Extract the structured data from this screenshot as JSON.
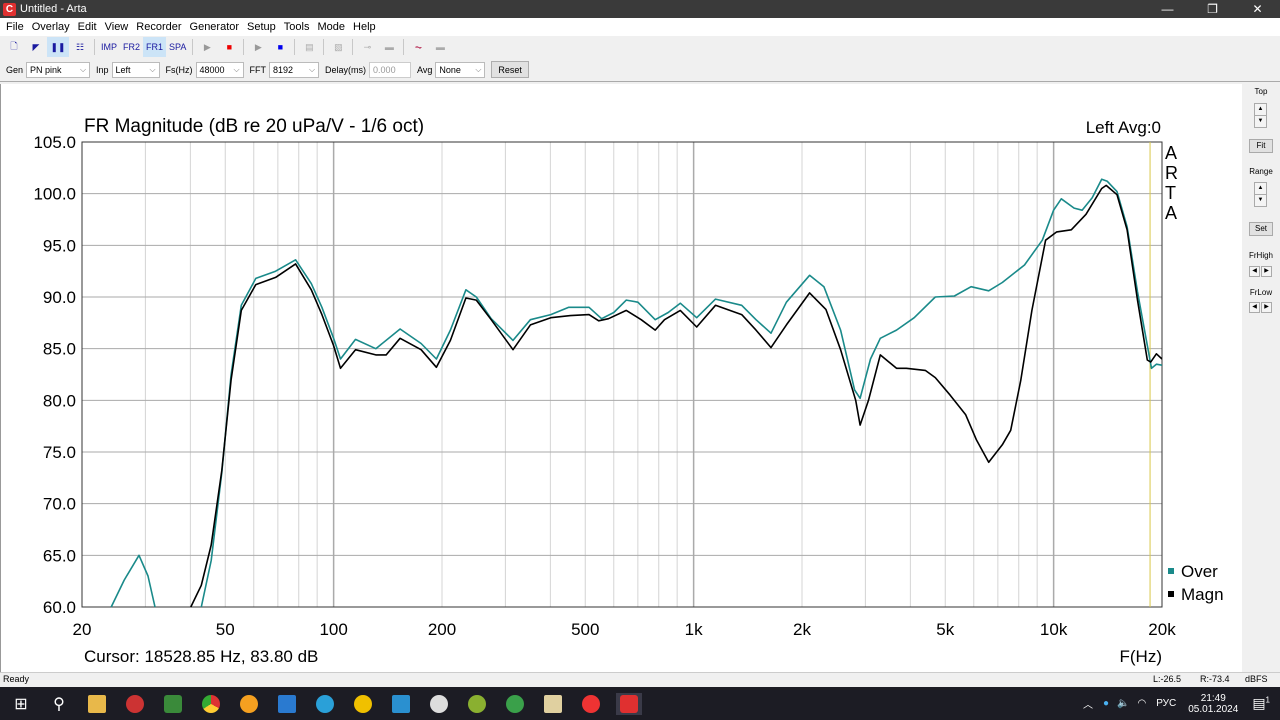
{
  "window": {
    "title": "Untitled - Arta",
    "minimize": "—",
    "maximize": "❐",
    "close": "✕"
  },
  "menu": [
    "File",
    "Overlay",
    "Edit",
    "View",
    "Recorder",
    "Generator",
    "Setup",
    "Tools",
    "Mode",
    "Help"
  ],
  "toolbar": {
    "imp": "IMP",
    "fr2": "FR2",
    "fr1": "FR1",
    "spa": "SPA"
  },
  "params": {
    "gen_label": "Gen",
    "gen_value": "PN pink",
    "inp_label": "Inp",
    "inp_value": "Left",
    "fs_label": "Fs(Hz)",
    "fs_value": "48000",
    "fft_label": "FFT",
    "fft_value": "8192",
    "delay_label": "Delay(ms)",
    "delay_value": "0.000",
    "avg_label": "Avg",
    "avg_value": "None",
    "reset": "Reset"
  },
  "right_panel": {
    "top": "Top",
    "fit": "Fit",
    "range": "Range",
    "set": "Set",
    "frhigh": "FrHigh",
    "frlow": "FrLow"
  },
  "status": {
    "ready": "Ready",
    "left": "L:-26.5",
    "right": "R:-73.4",
    "unit": "dBFS"
  },
  "tray": {
    "lang": "РУС",
    "time": "21:49",
    "date": "05.01.2024",
    "notif": "1"
  },
  "colors": {
    "over": "#1a8a8a",
    "magn": "#000000",
    "cursor": "#d8c84a",
    "grid": "#c8c8c8"
  },
  "chart_data": {
    "type": "line",
    "title": "FR Magnitude (dB re 20 uPa/V - 1/6 oct)",
    "channel_label": "Left  Avg:0",
    "watermark": "ARTA",
    "xlabel": "F(Hz)",
    "xscale": "log",
    "xlim": [
      20,
      20000
    ],
    "ylim": [
      60,
      105
    ],
    "xticks": [
      20,
      50,
      100,
      200,
      500,
      1000,
      2000,
      5000,
      10000,
      20000
    ],
    "xtick_labels": [
      "20",
      "50",
      "100",
      "200",
      "500",
      "1k",
      "2k",
      "5k",
      "10k",
      "20k"
    ],
    "yticks": [
      105,
      100,
      95,
      90,
      85,
      80,
      75,
      70,
      65,
      60
    ],
    "ytick_labels": [
      "105.0",
      "100.0",
      "95.0",
      "90.0",
      "85.0",
      "80.0",
      "75.0",
      "70.0",
      "65.0",
      "60.0"
    ],
    "cursor_text": "Cursor: 18528.85 Hz, 83.80 dB",
    "cursor_freq": 18528.85,
    "legend": "bottom-right",
    "series": [
      {
        "name": "Over",
        "color": "#1a8a8a",
        "segments": [
          [
            [
              24.1,
              60
            ],
            [
              26.2,
              62.6
            ],
            [
              28.8,
              65
            ],
            [
              30.5,
              63
            ],
            [
              31.9,
              60
            ]
          ],
          [
            [
              42.9,
              60
            ],
            [
              45.7,
              64.5
            ],
            [
              48.9,
              73
            ],
            [
              51.9,
              82.5
            ],
            [
              55.4,
              89.2
            ],
            [
              60.8,
              91.8
            ],
            [
              69,
              92.5
            ],
            [
              78.4,
              93.6
            ],
            [
              86.7,
              91.3
            ],
            [
              92.8,
              89
            ],
            [
              100,
              86
            ],
            [
              104.5,
              84
            ],
            [
              115,
              85.9
            ],
            [
              131,
              85
            ],
            [
              153,
              86.9
            ],
            [
              175,
              85.5
            ],
            [
              193,
              84
            ],
            [
              211,
              86.8
            ],
            [
              233,
              90.7
            ],
            [
              249,
              90
            ],
            [
              274,
              87.9
            ],
            [
              315,
              85.8
            ],
            [
              352,
              87.8
            ],
            [
              401,
              88.3
            ],
            [
              450,
              89
            ],
            [
              512,
              89
            ],
            [
              555,
              87.9
            ],
            [
              600,
              88.5
            ],
            [
              650,
              89.7
            ],
            [
              700,
              89.5
            ],
            [
              782,
              87.8
            ],
            [
              850,
              88.5
            ],
            [
              918,
              89.4
            ],
            [
              1020,
              88
            ],
            [
              1150,
              89.8
            ],
            [
              1360,
              89.2
            ],
            [
              1490,
              87.8
            ],
            [
              1640,
              86.5
            ],
            [
              1810,
              89.5
            ],
            [
              2100,
              92.1
            ],
            [
              2300,
              91
            ],
            [
              2560,
              86.8
            ],
            [
              2800,
              81
            ],
            [
              2900,
              80.2
            ],
            [
              3100,
              84
            ],
            [
              3300,
              86
            ],
            [
              3660,
              86.8
            ],
            [
              4100,
              88
            ],
            [
              4690,
              90
            ],
            [
              5300,
              90.1
            ],
            [
              5900,
              91
            ],
            [
              6600,
              90.6
            ],
            [
              7200,
              91.4
            ],
            [
              8300,
              93.1
            ],
            [
              9300,
              95.5
            ],
            [
              10000,
              98.4
            ],
            [
              10500,
              99.5
            ],
            [
              11400,
              98.6
            ],
            [
              12000,
              98.4
            ],
            [
              12800,
              99.6
            ],
            [
              13600,
              101.4
            ],
            [
              14100,
              101.2
            ],
            [
              15000,
              100.2
            ],
            [
              16000,
              96.8
            ],
            [
              17100,
              90.5
            ],
            [
              18700,
              83.1
            ],
            [
              19300,
              83.5
            ],
            [
              20000,
              83.4
            ]
          ]
        ]
      },
      {
        "name": "Magn",
        "color": "#000000",
        "segments": [
          [
            [
              40.1,
              60
            ],
            [
              42.9,
              62.1
            ],
            [
              45.7,
              66
            ],
            [
              48.9,
              73.2
            ],
            [
              51.9,
              82
            ],
            [
              55.4,
              88.7
            ],
            [
              60.8,
              91.2
            ],
            [
              69,
              91.9
            ],
            [
              78.4,
              93.2
            ],
            [
              86.7,
              90.7
            ],
            [
              92.8,
              88.3
            ],
            [
              100,
              85.3
            ],
            [
              104.5,
              83.1
            ],
            [
              115,
              84.9
            ],
            [
              131,
              84.4
            ],
            [
              140,
              84.4
            ],
            [
              153,
              86
            ],
            [
              175,
              84.9
            ],
            [
              193,
              83.2
            ],
            [
              211,
              85.8
            ],
            [
              233,
              89.9
            ],
            [
              249,
              89.7
            ],
            [
              274,
              87.8
            ],
            [
              315,
              84.9
            ],
            [
              352,
              87.3
            ],
            [
              401,
              88
            ],
            [
              455,
              88.2
            ],
            [
              512,
              88.3
            ],
            [
              545,
              87.7
            ],
            [
              580,
              87.9
            ],
            [
              650,
              88.7
            ],
            [
              715,
              87.8
            ],
            [
              782,
              86.8
            ],
            [
              830,
              87.8
            ],
            [
              918,
              88.7
            ],
            [
              1020,
              87.1
            ],
            [
              1150,
              89.2
            ],
            [
              1360,
              88.3
            ],
            [
              1490,
              86.8
            ],
            [
              1640,
              85.1
            ],
            [
              1810,
              87.3
            ],
            [
              2100,
              90.4
            ],
            [
              2330,
              88.8
            ],
            [
              2560,
              84.9
            ],
            [
              2820,
              80
            ],
            [
              2900,
              77.6
            ],
            [
              3060,
              80
            ],
            [
              3300,
              84.4
            ],
            [
              3660,
              83.1
            ],
            [
              3900,
              83.1
            ],
            [
              4400,
              82.9
            ],
            [
              4690,
              82.2
            ],
            [
              5160,
              80.5
            ],
            [
              5700,
              78.6
            ],
            [
              6100,
              76.2
            ],
            [
              6600,
              74
            ],
            [
              7200,
              75.7
            ],
            [
              7600,
              77.1
            ],
            [
              8100,
              81.9
            ],
            [
              8700,
              88.7
            ],
            [
              9500,
              95.5
            ],
            [
              10200,
              96.3
            ],
            [
              11200,
              96.5
            ],
            [
              12300,
              98
            ],
            [
              13600,
              100.5
            ],
            [
              14000,
              100.8
            ],
            [
              15000,
              99.9
            ],
            [
              16000,
              96.5
            ],
            [
              17100,
              89.7
            ],
            [
              18200,
              83.9
            ],
            [
              18600,
              83.7
            ],
            [
              19300,
              84.5
            ],
            [
              20000,
              84
            ]
          ]
        ]
      }
    ]
  }
}
